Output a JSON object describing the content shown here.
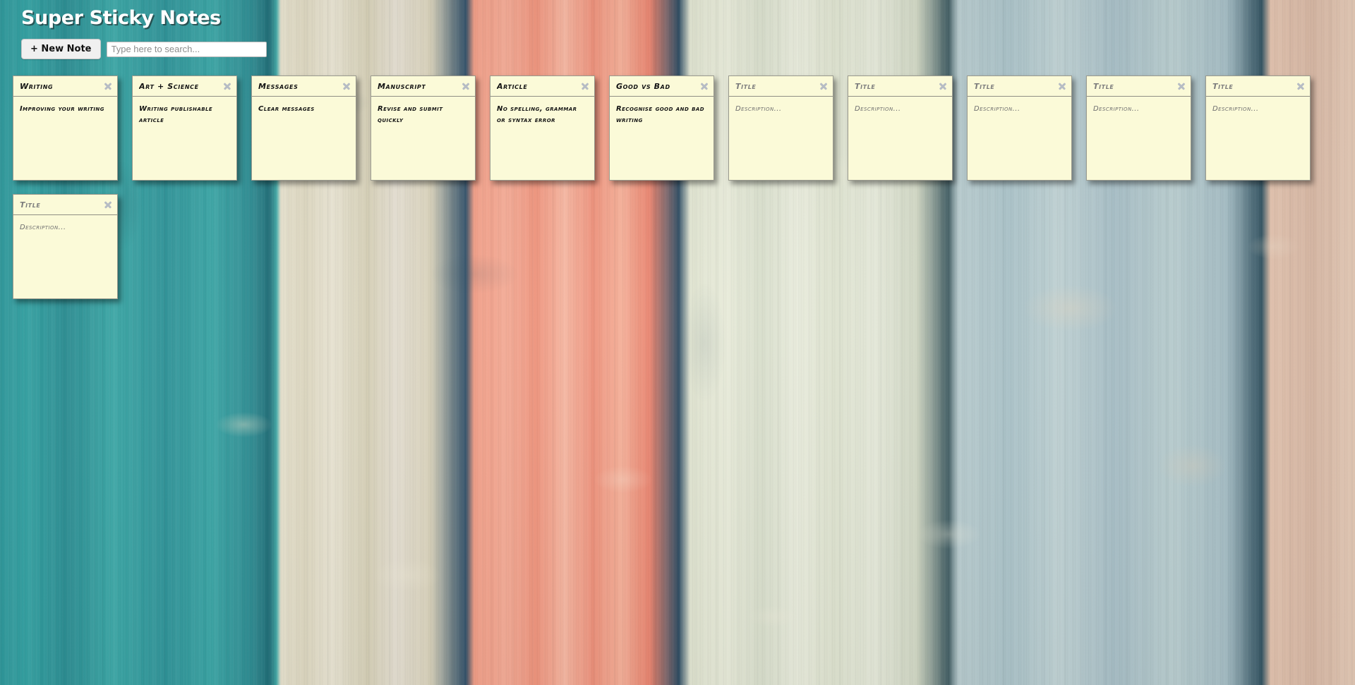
{
  "app": {
    "title": "Super Sticky Notes"
  },
  "toolbar": {
    "new_note_label": "+ New Note",
    "search_placeholder": "Type here to search...",
    "search_value": ""
  },
  "icons": {
    "close": "close-icon"
  },
  "colors": {
    "note_paper": "#FBFAD8",
    "note_border": "#9A9A8E",
    "close_icon": "#B6BCC4",
    "title_text": "#FFFFFF",
    "placeholder_text": "#7D7D7D"
  },
  "notes": [
    {
      "title": "Writing",
      "body": "Improving your writing",
      "title_is_placeholder": false,
      "body_is_placeholder": false
    },
    {
      "title": "Art + Science",
      "body": "Writing publishable article",
      "title_is_placeholder": false,
      "body_is_placeholder": false
    },
    {
      "title": "Messages",
      "body": "Clear messages",
      "title_is_placeholder": false,
      "body_is_placeholder": false
    },
    {
      "title": "Manuscript",
      "body": "Revise and submit quickly",
      "title_is_placeholder": false,
      "body_is_placeholder": false
    },
    {
      "title": "Article",
      "body": "No spelling, grammar or syntax error",
      "title_is_placeholder": false,
      "body_is_placeholder": false
    },
    {
      "title": "Good vs Bad",
      "body": "Recognise good and bad writing",
      "title_is_placeholder": false,
      "body_is_placeholder": false
    },
    {
      "title": "Title",
      "body": "Description...",
      "title_is_placeholder": true,
      "body_is_placeholder": true
    },
    {
      "title": "Title",
      "body": "Description...",
      "title_is_placeholder": true,
      "body_is_placeholder": true
    },
    {
      "title": "Title",
      "body": "Description...",
      "title_is_placeholder": true,
      "body_is_placeholder": true
    },
    {
      "title": "Title",
      "body": "Description...",
      "title_is_placeholder": true,
      "body_is_placeholder": true
    },
    {
      "title": "Title",
      "body": "Description...",
      "title_is_placeholder": true,
      "body_is_placeholder": true
    },
    {
      "title": "Title",
      "body": "Description...",
      "title_is_placeholder": true,
      "body_is_placeholder": true
    }
  ]
}
